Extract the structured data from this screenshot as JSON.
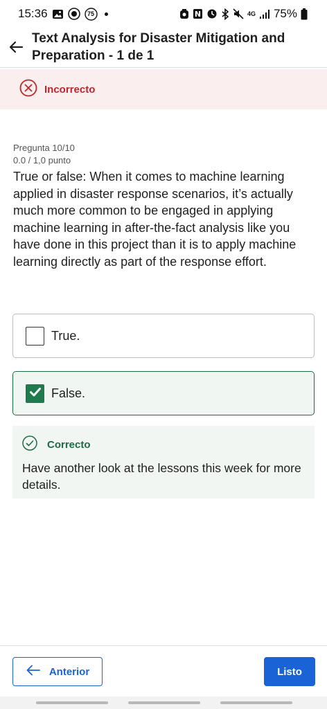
{
  "status_bar": {
    "time": "15:36",
    "notif_badge": "75",
    "network": "4G",
    "battery": "75%"
  },
  "header": {
    "title": "Text Analysis for Disaster Mitigation and Preparation - 1 de 1",
    "back_icon": "arrow-left-icon"
  },
  "banner": {
    "label": "Incorrecto",
    "icon": "close-circle-icon",
    "color": "#c0252b"
  },
  "question": {
    "number": "Pregunta 10/10",
    "points": "0.0 / 1,0 punto",
    "text": "True or false: When it comes to machine learning applied in disaster response scenarios, it’s actually much more common to be engaged in applying machine learning in after-the-fact analysis like you have done in this project than it is to apply machine learning directly as part of the response effort."
  },
  "options": [
    {
      "label": "True.",
      "checked": false
    },
    {
      "label": "False.",
      "checked": true
    }
  ],
  "feedback": {
    "label": "Correcto",
    "text": "Have another look at the lessons this week for more details.",
    "color": "#1e6a43"
  },
  "footer": {
    "prev_label": "Anterior",
    "done_label": "Listo",
    "accent": "#1a63d6"
  }
}
